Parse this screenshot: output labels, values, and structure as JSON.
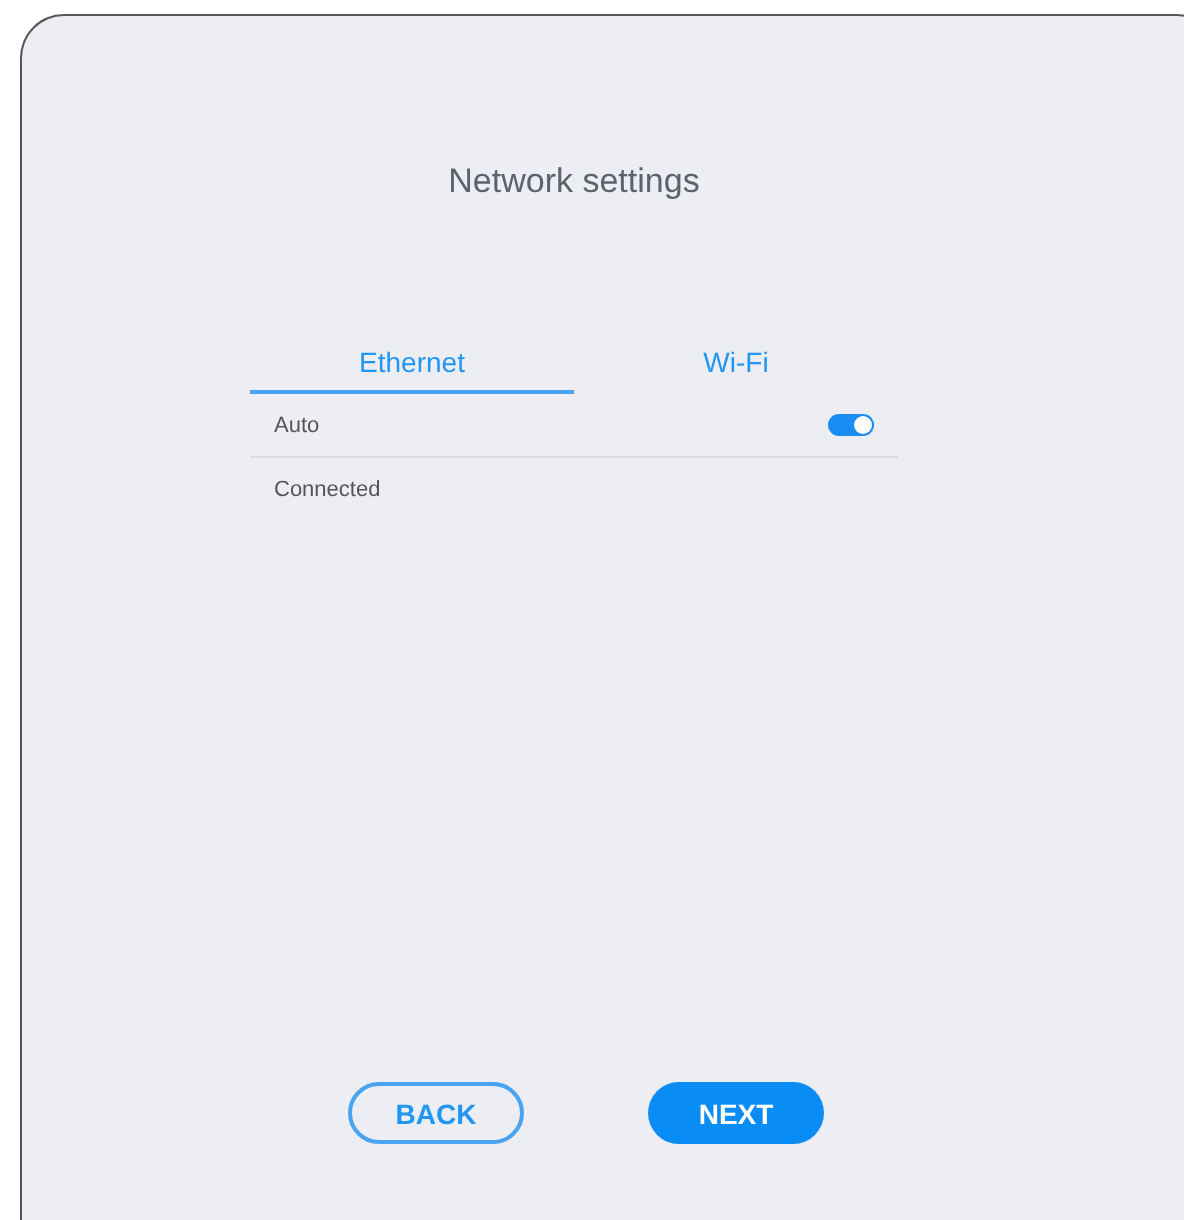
{
  "title": "Network settings",
  "tabs": [
    {
      "label": "Ethernet",
      "selected": true
    },
    {
      "label": "Wi-Fi",
      "selected": false
    }
  ],
  "rows": [
    {
      "kind": "toggle",
      "label": "Auto",
      "on": true
    },
    {
      "kind": "text",
      "label": "Connected"
    }
  ],
  "buttons": [
    {
      "label": "BACK",
      "kind": "outline"
    },
    {
      "label": "NEXT",
      "kind": "primary"
    }
  ]
}
